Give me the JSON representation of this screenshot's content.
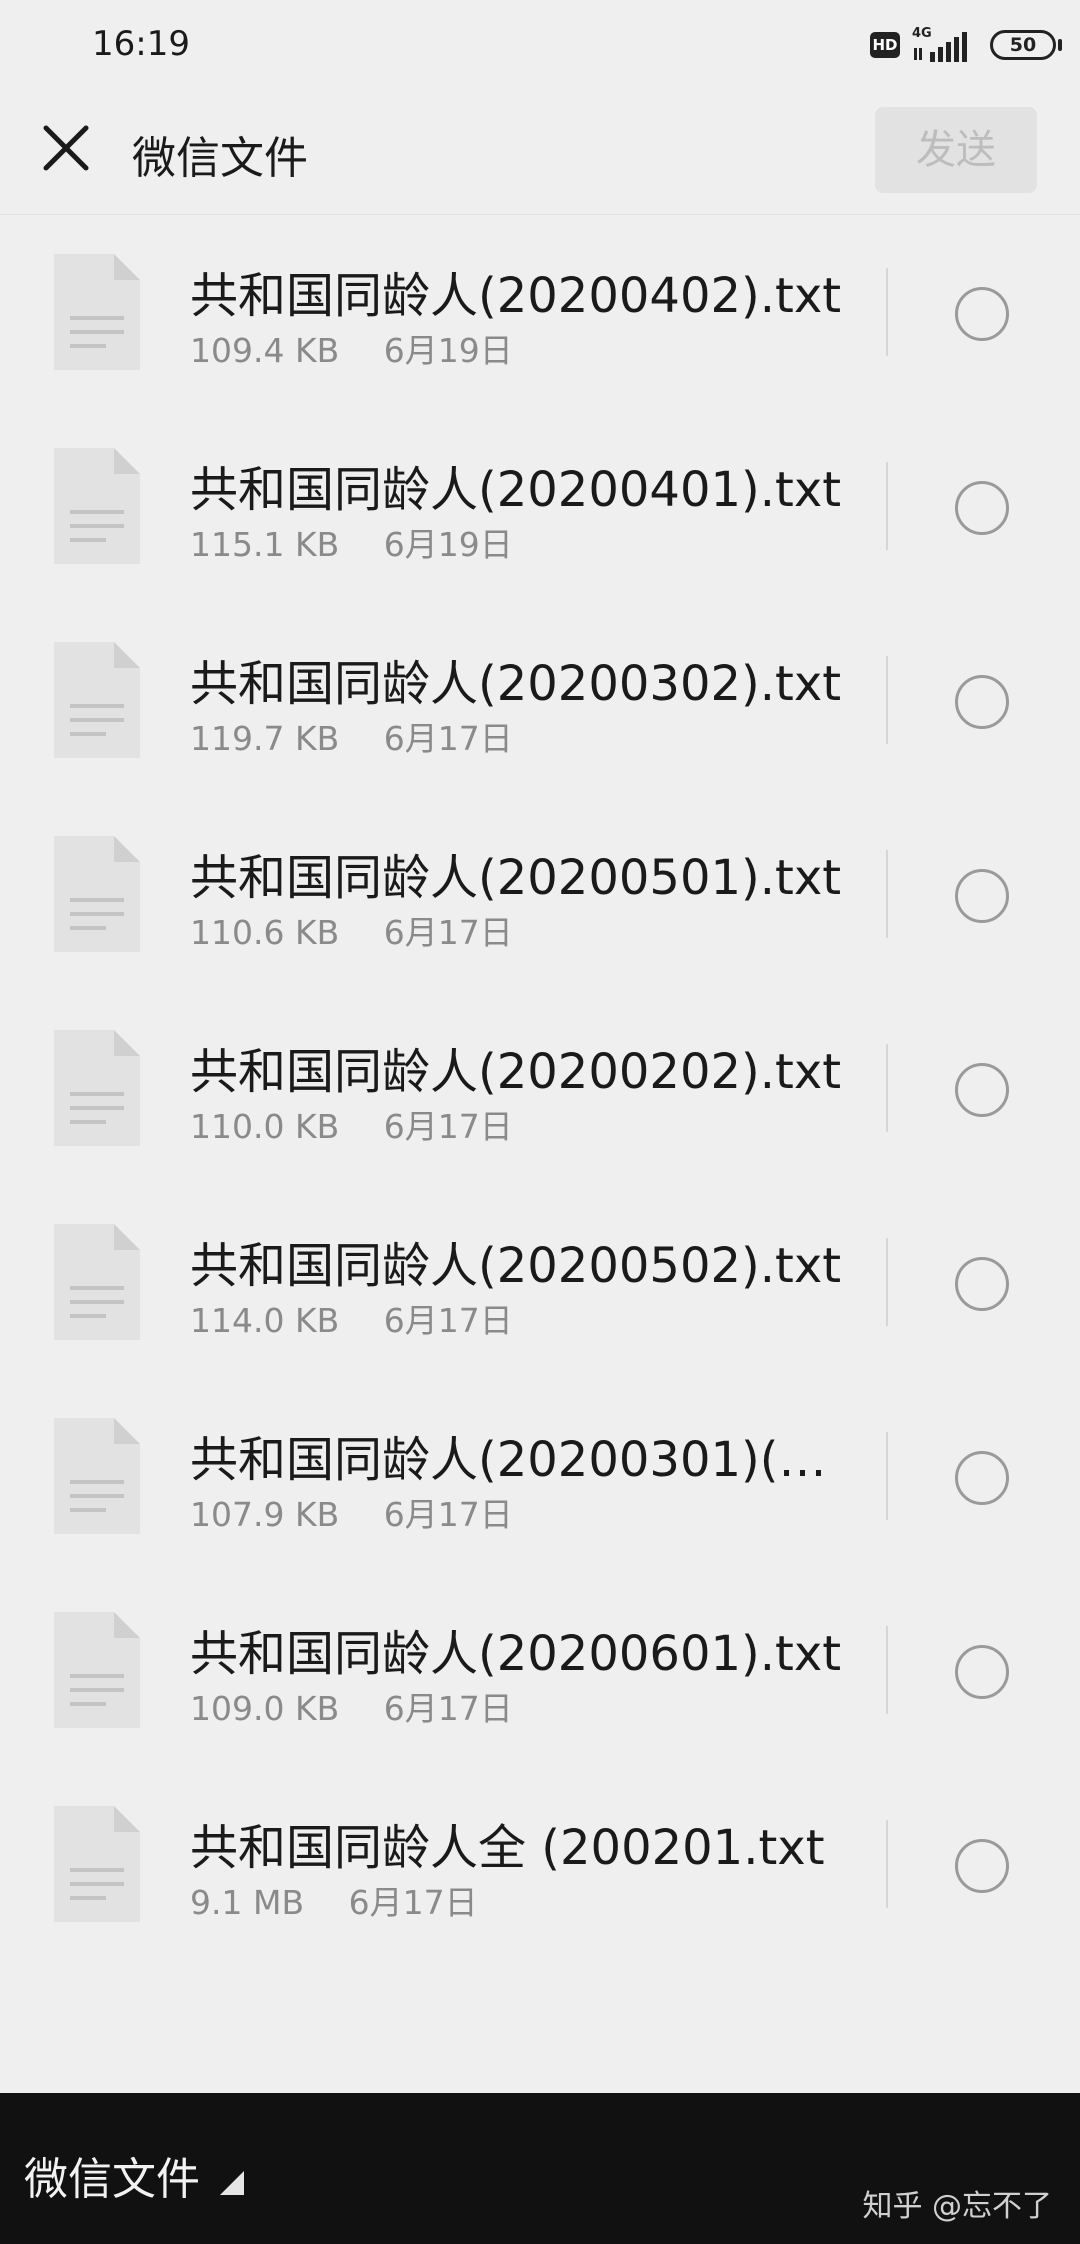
{
  "status_bar": {
    "time": "16:19",
    "hd_label": "HD",
    "network_label": "4G",
    "battery_level": "50"
  },
  "header": {
    "title": "微信文件",
    "send_label": "发送"
  },
  "files": [
    {
      "name": "共和国同龄人(20200402).txt",
      "size": "109.4 KB",
      "date": "6月19日"
    },
    {
      "name": "共和国同龄人(20200401).txt",
      "size": "115.1 KB",
      "date": "6月19日"
    },
    {
      "name": "共和国同龄人(20200302).txt",
      "size": "119.7 KB",
      "date": "6月17日"
    },
    {
      "name": "共和国同龄人(20200501).txt",
      "size": "110.6 KB",
      "date": "6月17日"
    },
    {
      "name": "共和国同龄人(20200202).txt",
      "size": "110.0 KB",
      "date": "6月17日"
    },
    {
      "name": "共和国同龄人(20200502).txt",
      "size": "114.0 KB",
      "date": "6月17日"
    },
    {
      "name": "共和国同龄人(20200301)(2…",
      "size": "107.9 KB",
      "date": "6月17日"
    },
    {
      "name": "共和国同龄人(20200601).txt",
      "size": "109.0 KB",
      "date": "6月17日"
    },
    {
      "name": "共和国同龄人全 (200201.txt",
      "size": "9.1 MB",
      "date": "6月17日"
    }
  ],
  "bottom_bar": {
    "source_label": "微信文件",
    "watermark": "知乎 @忘不了"
  }
}
